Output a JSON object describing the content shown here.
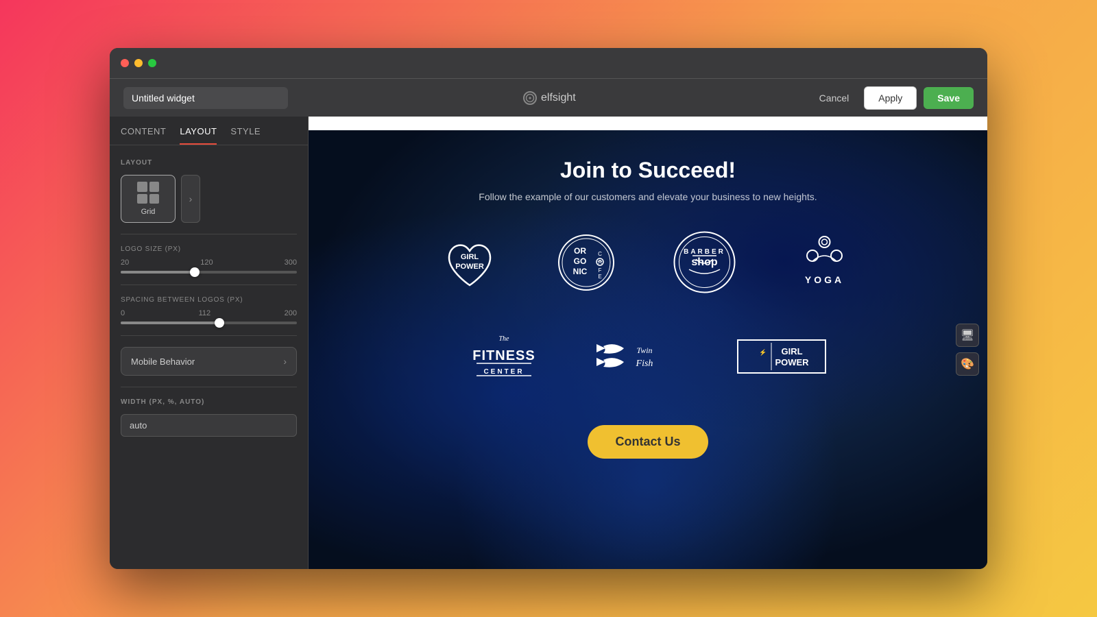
{
  "browser": {
    "traffic_lights": [
      "red",
      "yellow",
      "green"
    ]
  },
  "toolbar": {
    "widget_title": "Untitled widget",
    "logo_text": "elfsight",
    "cancel_label": "Cancel",
    "apply_label": "Apply",
    "save_label": "Save"
  },
  "sidebar": {
    "tabs": [
      {
        "id": "content",
        "label": "CONTENT"
      },
      {
        "id": "layout",
        "label": "LAYOUT",
        "active": true
      },
      {
        "id": "style",
        "label": "STYLE"
      }
    ],
    "layout_section_label": "LAYOUT",
    "layout_options": [
      {
        "id": "grid",
        "label": "Grid",
        "selected": true
      }
    ],
    "logo_size": {
      "label": "LOGO SIZE (PX)",
      "min": 20,
      "max": 300,
      "value": 120,
      "percent": 42
    },
    "spacing": {
      "label": "SPACING BETWEEN LOGOS (PX)",
      "min": 0,
      "max": 200,
      "value": 112,
      "percent": 56
    },
    "mobile_behavior": {
      "label": "Mobile Behavior"
    },
    "width_section": {
      "label": "WIDTH (PX, %, AUTO)",
      "value": "auto"
    }
  },
  "preview": {
    "heading": "Join to Succeed!",
    "subheading": "Follow the example of our customers and elevate your business to new heights.",
    "contact_button": "Contact Us",
    "logos": [
      {
        "id": "girl-power",
        "alt": "Girl Power"
      },
      {
        "id": "organic-cafe",
        "alt": "Organic Cafe"
      },
      {
        "id": "barber-shop",
        "alt": "Barber Shop"
      },
      {
        "id": "yoga",
        "alt": "Yoga"
      },
      {
        "id": "fitness-center",
        "alt": "The Fitness Center"
      },
      {
        "id": "twin-fish",
        "alt": "Twin Fish"
      },
      {
        "id": "girl-power-2",
        "alt": "Girl Power 2"
      }
    ]
  },
  "icons": {
    "monitor": "🖥",
    "brush": "🎨",
    "chevron_right": "›"
  }
}
